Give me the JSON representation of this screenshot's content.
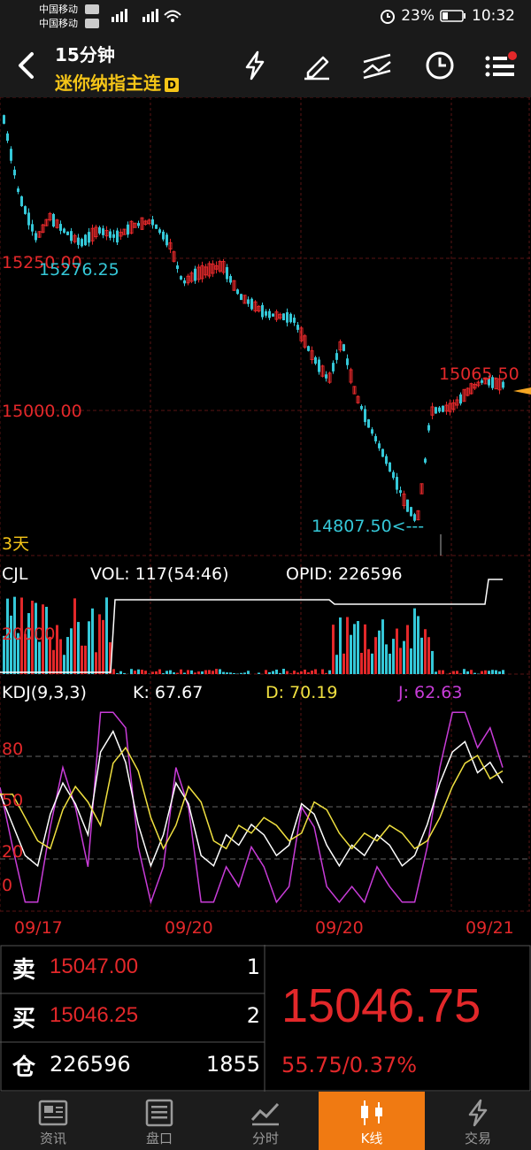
{
  "status_bar": {
    "carrier1": "中国移动",
    "carrier2": "中国移动",
    "battery": "23%",
    "time": "10:32"
  },
  "header": {
    "period": "15分钟",
    "instrument": "迷你纳指主连",
    "badge": "D"
  },
  "price_chart": {
    "levels": [
      "15250.00",
      "15000.00"
    ],
    "annotations": {
      "peak_left": "15276.25",
      "high_right": "15065.50",
      "low": "14807.50<---",
      "range": "3天"
    },
    "colors": {
      "up": "#e3282a",
      "down": "#35c8d8",
      "accent": "#f5a623"
    }
  },
  "volume_panel": {
    "name": "CJL",
    "vol": "VOL: 117(54:46)",
    "opid": "OPID: 226596",
    "level": "20000"
  },
  "kdj_panel": {
    "name": "KDJ(9,3,3)",
    "k": "K: 67.67",
    "d": "D: 70.19",
    "j": "J: 62.63",
    "levels": [
      "80",
      "50",
      "20",
      "0"
    ],
    "colors": {
      "k": "#ffffff",
      "d": "#f0e040",
      "j": "#c83cd8"
    }
  },
  "x_axis": [
    "09/17",
    "09/20",
    "09/20",
    "09/21"
  ],
  "quote": {
    "sell_label": "卖",
    "sell_price": "15047.00",
    "sell_qty": "1",
    "buy_label": "买",
    "buy_price": "15046.25",
    "buy_qty": "2",
    "oi_label": "仓",
    "oi_value": "226596",
    "oi_change": "1855",
    "last_price": "15046.75",
    "change": "55.75/0.37%"
  },
  "nav": {
    "items": [
      "资讯",
      "盘口",
      "分时",
      "K线",
      "交易"
    ],
    "active": "K线"
  }
}
